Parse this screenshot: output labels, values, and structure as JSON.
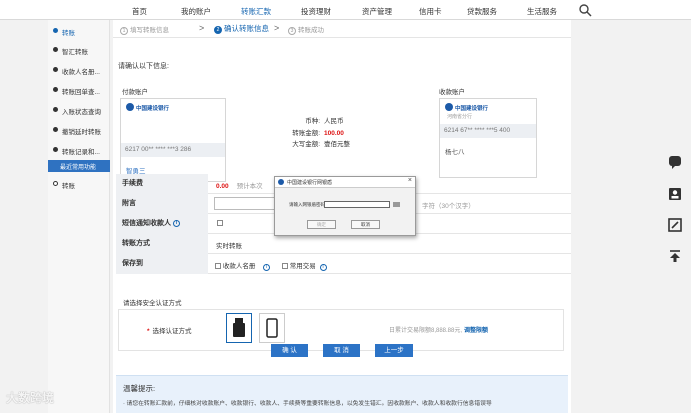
{
  "topnav": {
    "items": [
      "首页",
      "我的账户",
      "转账汇款",
      "投资理财",
      "资产管理",
      "信用卡",
      "贷款服务",
      "生活服务"
    ],
    "active_index": 2,
    "search_icon": "search-icon"
  },
  "sidebar": {
    "items": [
      "转账",
      "智汇转账",
      "收款人名册...",
      "转账回单查...",
      "入账状态查询",
      "撤销延时转账",
      "转账记录和...",
      "最近常用功能",
      "转账"
    ]
  },
  "steps": {
    "step1": "填写转账信息",
    "step2": "确认转账信息",
    "step3": "转账成功",
    "active": 2
  },
  "confirm_label": "请确认以下信息:",
  "payer": {
    "title": "付款账户",
    "bank": "中国建设银行",
    "account": "6217 00** **** ***3 286",
    "holder": "智勇三"
  },
  "payee": {
    "title": "收款账户",
    "bank": "中国建设银行",
    "branch": "河南省分行",
    "account": "6214 67** **** ***5 400",
    "holder": "杨七八"
  },
  "transfer_info": {
    "currency_label": "币种:",
    "currency_value": "人民币",
    "amount_label": "转账金额:",
    "amount_value": "100.00",
    "upper_label": "大写金额:",
    "upper_value": "壹佰元整"
  },
  "form": {
    "fee_label": "手续费",
    "fee_value": "0.00",
    "fee_note": "预计本次",
    "remark_label": "附言",
    "remark_hint": "字符（30个汉字）",
    "sms_label": "短信通知收款人",
    "method_label": "转账方式",
    "method_value": "实时转账",
    "save_label": "保存到",
    "save_opt1": "收款人名册",
    "save_opt2": "常用交易"
  },
  "security": {
    "title": "请选择安全认证方式",
    "method_label": "选择认证方式",
    "limit_text": "日累计交易限额8,888.88元,",
    "limit_link": "调整限额"
  },
  "buttons": {
    "confirm": "确 认",
    "cancel": "取 消",
    "prev": "上一步"
  },
  "tips": {
    "title": "温馨提示:",
    "line1": "· 请您在转账汇款前，仔细核对收款账户、收款银行、收款人、手续费等重要转账信息，以免发生错汇。因收款账户、收款人和收款行信息错误导"
  },
  "dialog": {
    "title": "中国建设银行网银盾",
    "pin_label": "请输入网银盾密码:",
    "ok": "确定",
    "cancel": "取消"
  },
  "watermark": "大数跨境",
  "colors": {
    "brand_blue": "#1565b0",
    "button_blue": "#2c73c6",
    "amount_red": "#dd1111"
  }
}
